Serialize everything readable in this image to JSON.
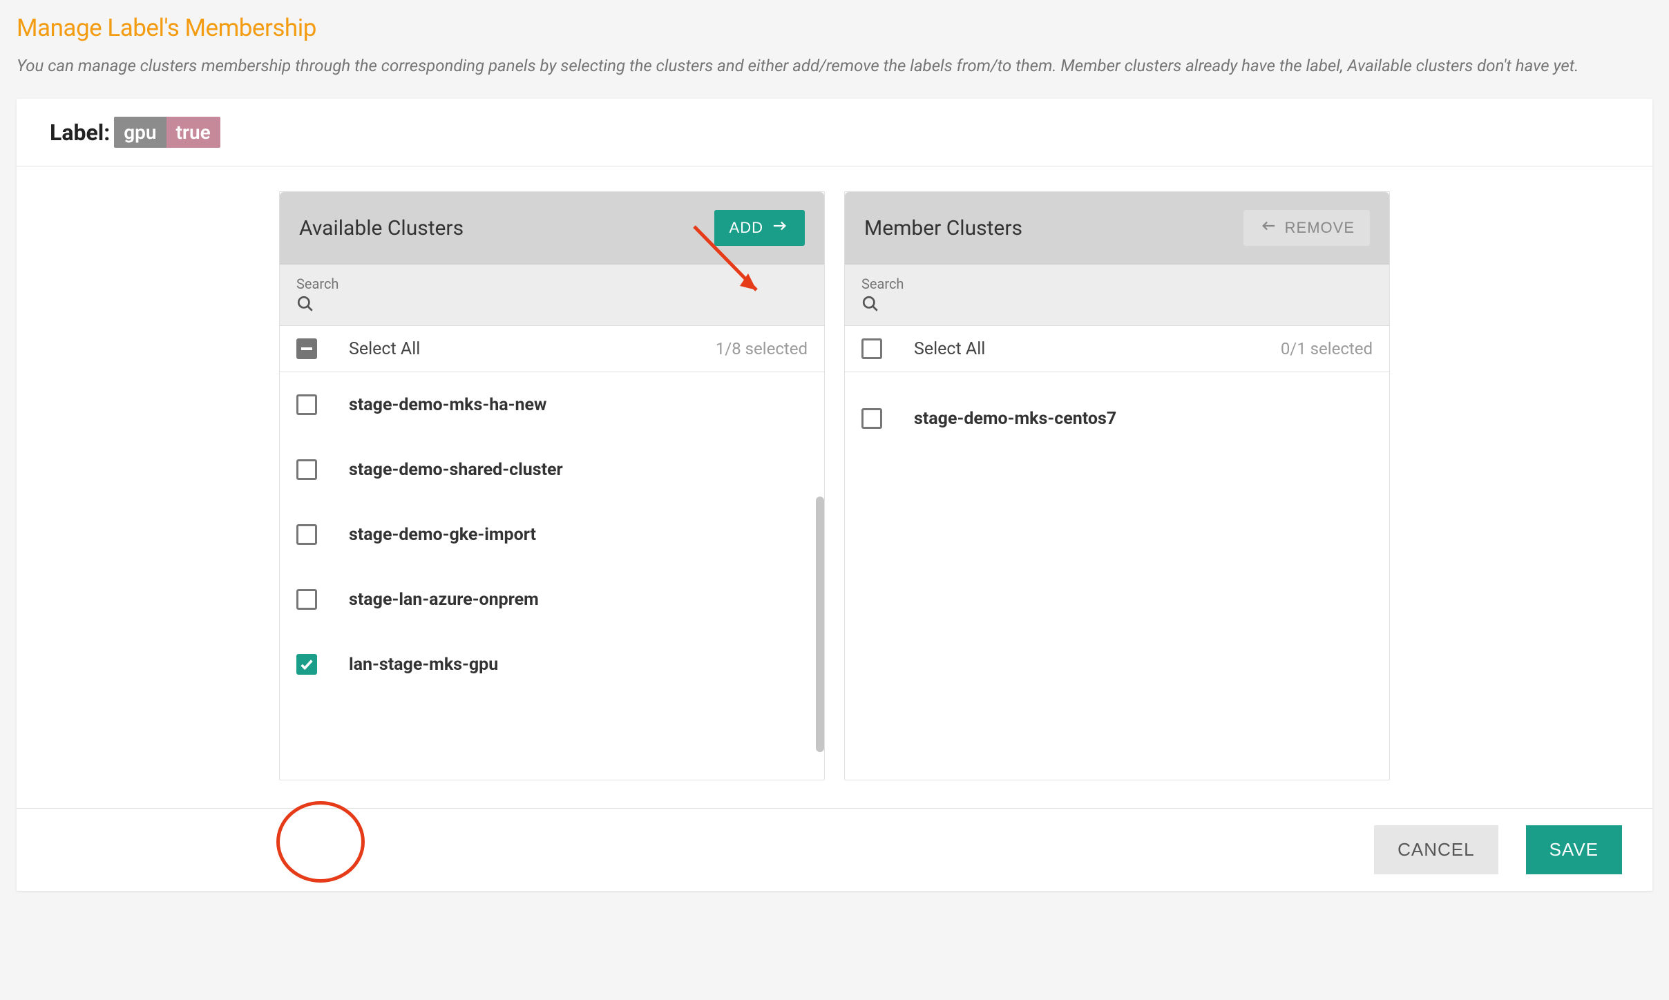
{
  "page": {
    "title": "Manage Label's Membership",
    "description": "You can manage clusters membership through the corresponding panels by selecting the clusters and either add/remove the labels from/to them. Member clusters already have the label, Available clusters don't have yet."
  },
  "label": {
    "prefix": "Label:",
    "key": "gpu",
    "value": "true"
  },
  "available": {
    "title": "Available Clusters",
    "add_btn": "ADD",
    "search_label": "Search",
    "select_all": "Select All",
    "selected_counter": "1/8 selected",
    "items": [
      {
        "name": "stage-demo-mks-ha-new",
        "checked": false
      },
      {
        "name": "stage-demo-shared-cluster",
        "checked": false
      },
      {
        "name": "stage-demo-gke-import",
        "checked": false
      },
      {
        "name": "stage-lan-azure-onprem",
        "checked": false
      },
      {
        "name": "lan-stage-mks-gpu",
        "checked": true
      }
    ]
  },
  "members": {
    "title": "Member Clusters",
    "remove_btn": "REMOVE",
    "search_label": "Search",
    "select_all": "Select All",
    "selected_counter": "0/1 selected",
    "items": [
      {
        "name": "stage-demo-mks-centos7",
        "checked": false
      }
    ]
  },
  "footer": {
    "cancel": "CANCEL",
    "save": "SAVE"
  }
}
